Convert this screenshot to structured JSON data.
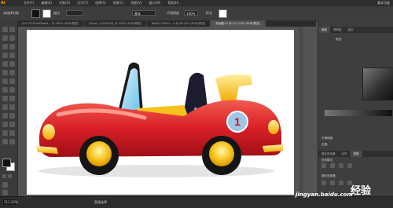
{
  "app": {
    "logo": "Ai"
  },
  "menu": {
    "items": [
      "文件(F)",
      "编辑(E)",
      "对象(O)",
      "文字(T)",
      "选择(S)",
      "效果(C)",
      "视图(V)",
      "窗口(W)",
      "帮助(H)"
    ],
    "right": "基本功能"
  },
  "control_bar": {
    "selection": "未选择对象",
    "stroke_label": "描边",
    "stroke_value": "",
    "brush_value": "基本",
    "opacity_label": "不透明度",
    "opacity_value": "100%",
    "style_label": "样式"
  },
  "tabs": [
    {
      "label": "2b7751519408d94… @ 265% (RGB/预览)",
      "active": false
    },
    {
      "label": "Ellipse_20180208_@ 100% (RGB/预览)",
      "active": false
    },
    {
      "label": "8b8217465cc…e @ 66.43% (RGB/预览)",
      "active": false
    },
    {
      "label": "未标题-2* @ 111.22% (RGB/预览)",
      "active": true
    }
  ],
  "status_bar": {
    "zoom": "111.22%",
    "tool": "直接选择"
  },
  "panels": {
    "tabs_top": [
      "渐变",
      "透明度",
      "描边"
    ],
    "gradient_type_label": "类型:",
    "gradient_type_value": "",
    "angle_label": "不透明度:",
    "position_label": "位置:",
    "tabs_bottom": [
      "路径查找器",
      "对齐",
      "变换"
    ],
    "shape_mode_label": "形状模式:",
    "pathfinder_label": "路径查找器:",
    "expand_label": "扩展"
  },
  "watermark": {
    "site": "jingyan.baidu.com",
    "brand": "经验"
  },
  "colors": {
    "ui_dark": "#2e2e2e",
    "canvas_bg": "#535353",
    "car_red": "#d81f26",
    "car_yellow": "#f6c21b",
    "window_blue": "#8fd3f0",
    "badge_blue": "#9fc4e5"
  },
  "illustration": {
    "badge_number": "1"
  }
}
